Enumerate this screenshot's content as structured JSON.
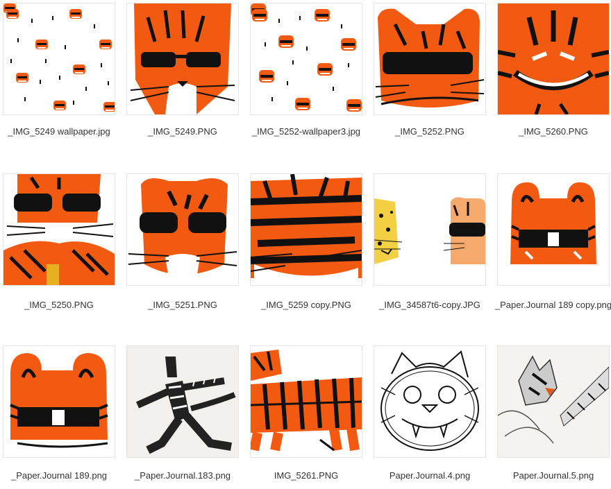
{
  "files": [
    {
      "name": "_IMG_5249 wallpaper.jpg",
      "thumbnail": "tiger-wallpaper-pattern"
    },
    {
      "name": "_IMG_5249.PNG",
      "thumbnail": "tiger-face-sunglasses"
    },
    {
      "name": "_IMG_5252-wallpaper3.jpg",
      "thumbnail": "tiger-wallpaper-pattern"
    },
    {
      "name": "_IMG_5252.PNG",
      "thumbnail": "tiger-face-sunglasses"
    },
    {
      "name": "_IMG_5260.PNG",
      "thumbnail": "tiger-face-grin"
    },
    {
      "name": "_IMG_5250.PNG",
      "thumbnail": "tiger-sunglasses-body"
    },
    {
      "name": "_IMG_5251.PNG",
      "thumbnail": "tiger-face-sunglasses"
    },
    {
      "name": "_IMG_5259 copy.PNG",
      "thumbnail": "tiger-stripes-abstract"
    },
    {
      "name": "_IMG_34587t6-copy.JPG",
      "thumbnail": "leopard-and-tiger"
    },
    {
      "name": "_Paper.Journal 189 copy.png",
      "thumbnail": "tiger-face-blocky"
    },
    {
      "name": "_Paper.Journal 189.png",
      "thumbnail": "tiger-face-blocky"
    },
    {
      "name": "_Paper.Journal.183.png",
      "thumbnail": "tiger-running-sketch"
    },
    {
      "name": "IMG_5261.PNG",
      "thumbnail": "tiger-walking"
    },
    {
      "name": "Paper.Journal.4.png",
      "thumbnail": "tiger-face-sketch"
    },
    {
      "name": "Paper.Journal.5.png",
      "thumbnail": "tiger-pencil-sketch"
    }
  ],
  "colors": {
    "tiger_orange": "#f25a12",
    "stripe": "#111111",
    "label": "#333333",
    "border": "#e4e4e4"
  }
}
